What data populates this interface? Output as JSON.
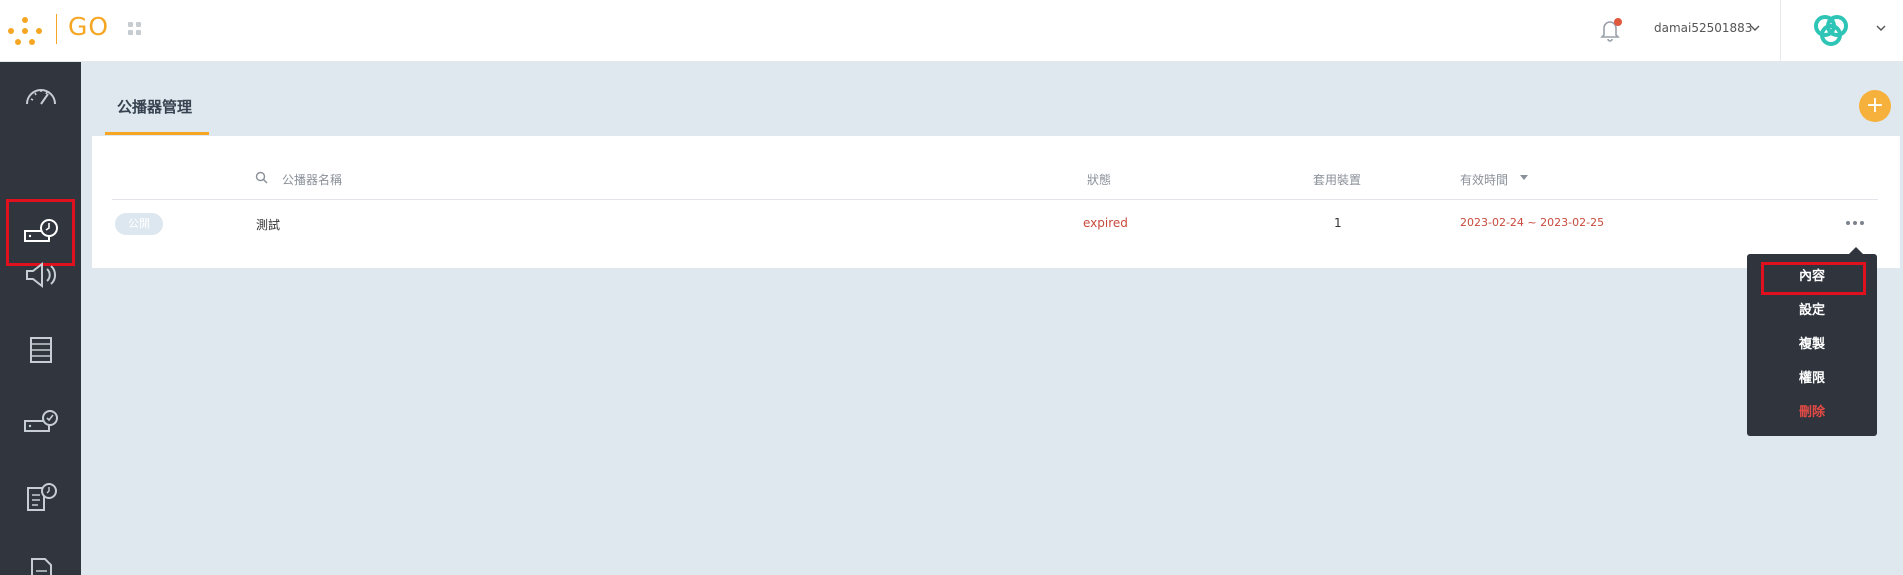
{
  "app": {
    "logo_text": "GO",
    "brand_color": "#f5a623"
  },
  "header": {
    "username": "damai52501883",
    "notification_badge_color": "#e0583e"
  },
  "sidebar": {
    "items": [
      {
        "icon": "dashboard-gauge-icon"
      },
      {
        "icon": "player-schedule-icon",
        "selected": true
      },
      {
        "icon": "broadcast-speaker-icon"
      },
      {
        "icon": "list-storage-icon"
      },
      {
        "icon": "device-check-icon"
      },
      {
        "icon": "report-schedule-icon"
      },
      {
        "icon": "document-icon"
      }
    ]
  },
  "page": {
    "title": "公播器管理",
    "add_button_label": "+"
  },
  "table": {
    "columns": {
      "name_placeholder": "公播器名稱",
      "status": "狀態",
      "devices": "套用裝置",
      "validity": "有效時間"
    },
    "rows": [
      {
        "tag": "公開",
        "name": "測試",
        "status": "expired",
        "devices": "1",
        "validity": "2023-02-24 ~ 2023-02-25"
      }
    ]
  },
  "context_menu": {
    "items": [
      {
        "label": "內容",
        "highlighted": true
      },
      {
        "label": "設定"
      },
      {
        "label": "複製"
      },
      {
        "label": "權限"
      },
      {
        "label": "刪除",
        "danger": true
      }
    ]
  }
}
